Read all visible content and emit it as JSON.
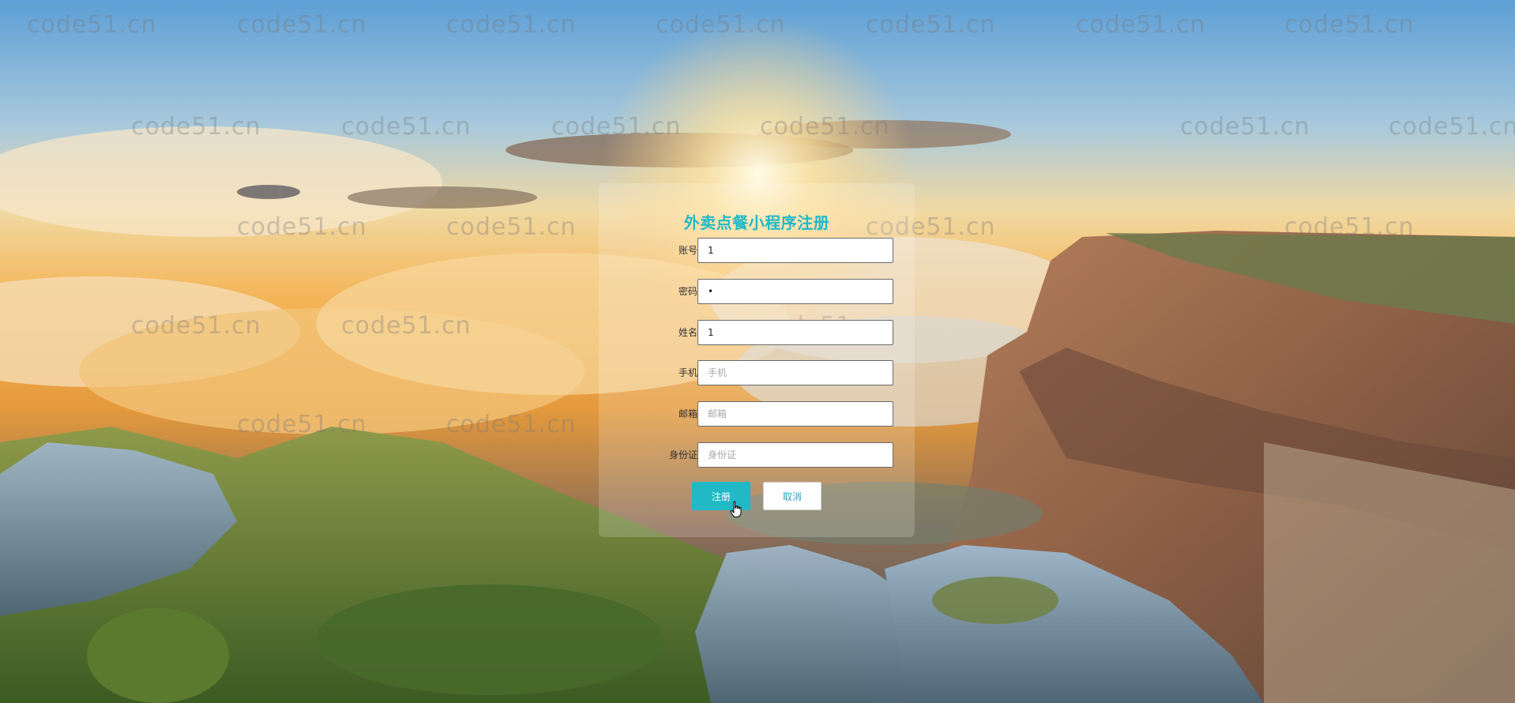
{
  "form": {
    "title": "外卖点餐小程序注册",
    "fields": [
      {
        "label": "账号",
        "value": "1",
        "placeholder": "",
        "type": "text"
      },
      {
        "label": "密码",
        "value": "•",
        "placeholder": "",
        "type": "text"
      },
      {
        "label": "姓名",
        "value": "1",
        "placeholder": "",
        "type": "text"
      },
      {
        "label": "手机",
        "value": "",
        "placeholder": "手机",
        "type": "text"
      },
      {
        "label": "邮箱",
        "value": "",
        "placeholder": "邮箱",
        "type": "text"
      },
      {
        "label": "身份证",
        "value": "",
        "placeholder": "身份证",
        "type": "text"
      }
    ],
    "register_label": "注册",
    "cancel_label": "取消"
  },
  "watermark": {
    "text": "code51.cn"
  },
  "colors": {
    "title": "#1fb8c8",
    "register_button": "#21b9c6",
    "cancel_text": "#2aa0c8"
  },
  "icons": {
    "cursor": "hand-pointer-icon"
  }
}
